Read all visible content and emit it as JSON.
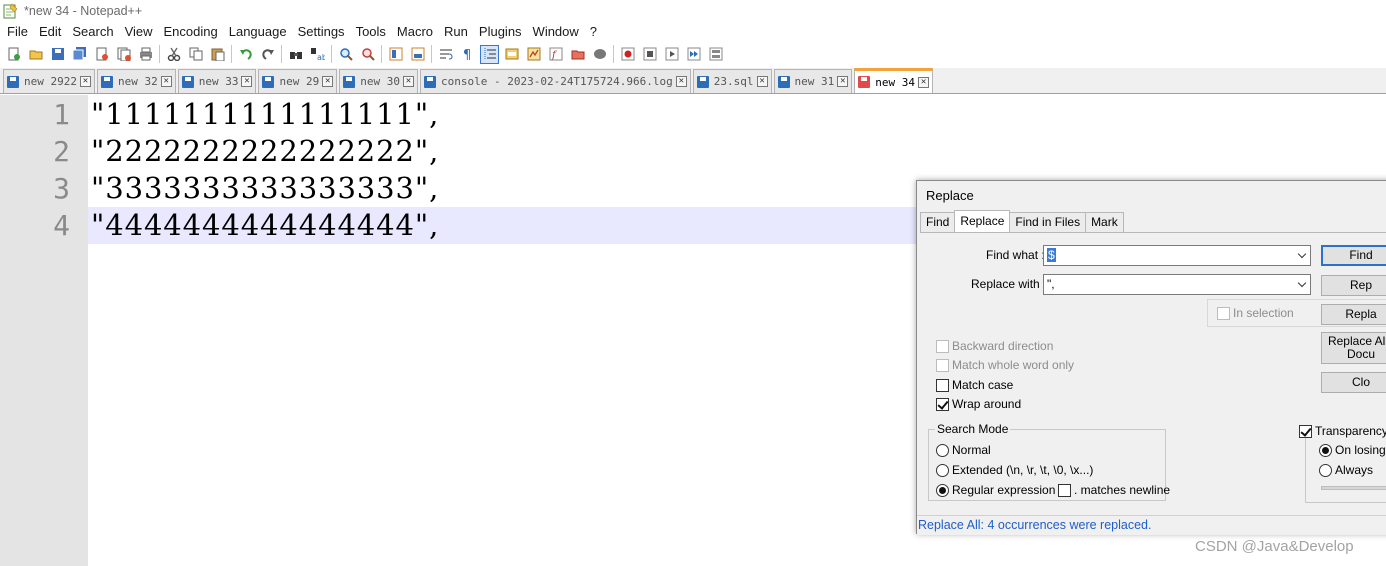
{
  "window": {
    "title": "*new 34 - Notepad++"
  },
  "menu": [
    "File",
    "Edit",
    "Search",
    "View",
    "Encoding",
    "Language",
    "Settings",
    "Tools",
    "Macro",
    "Run",
    "Plugins",
    "Window",
    "?"
  ],
  "toolbar_icons": [
    "new-file-icon",
    "open-file-icon",
    "save-icon",
    "save-all-icon",
    "close-icon",
    "close-all-icon",
    "print-icon",
    "cut-icon",
    "copy-icon",
    "paste-icon",
    "undo-icon",
    "redo-icon",
    "find-icon",
    "replace-icon",
    "zoom-in-icon",
    "zoom-out-icon",
    "sync-vertical-icon",
    "sync-horizontal-icon",
    "word-wrap-icon",
    "show-all-chars-icon",
    "indent-guide-icon",
    "user-language-icon",
    "document-map-icon",
    "function-list-icon",
    "folder-as-workspace-icon",
    "monitoring-icon",
    "record-macro-icon",
    "stop-record-icon",
    "play-macro-icon",
    "run-macro-multiple-icon",
    "save-macro-icon"
  ],
  "tabs": [
    {
      "label": "new 2922",
      "active": false
    },
    {
      "label": "new 32",
      "active": false
    },
    {
      "label": "new 33",
      "active": false
    },
    {
      "label": "new 29",
      "active": false
    },
    {
      "label": "new 30",
      "active": false
    },
    {
      "label": "console - 2023-02-24T175724.966.log",
      "active": false
    },
    {
      "label": "23.sql",
      "active": false
    },
    {
      "label": "new 31",
      "active": false
    },
    {
      "label": "new 34",
      "active": true
    }
  ],
  "editor": {
    "lines": [
      {
        "num": "1",
        "text": "\"1111111111111111\","
      },
      {
        "num": "2",
        "text": "\"2222222222222222\","
      },
      {
        "num": "3",
        "text": "\"3333333333333333\","
      },
      {
        "num": "4",
        "text": "\"4444444444444444\","
      }
    ],
    "current_line": 4
  },
  "dialog": {
    "title": "Replace",
    "tabs": [
      "Find",
      "Replace",
      "Find in Files",
      "Mark"
    ],
    "active_tab": "Replace",
    "find_label": "Find what :",
    "find_value": "$",
    "replace_label": "Replace with :",
    "replace_value": "\",",
    "in_selection": "In selection",
    "options": {
      "backward": "Backward direction",
      "whole_word": "Match whole word only",
      "match_case": "Match case",
      "wrap_around": "Wrap around"
    },
    "search_mode": {
      "title": "Search Mode",
      "normal": "Normal",
      "extended": "Extended (\\n, \\r, \\t, \\0, \\x...)",
      "regex": "Regular expression",
      "matches_newline": ". matches newline"
    },
    "transparency": {
      "title": "Transparency",
      "on_losing_focus": "On losing f",
      "always": "Always"
    },
    "buttons": {
      "find": "Find",
      "replace": "Rep",
      "replace_all": "Repla",
      "replace_all_docs_line1": "Replace All i",
      "replace_all_docs_line2": "Docu",
      "close": "Clo"
    },
    "status": "Replace All: 4 occurrences were replaced."
  },
  "watermark": "CSDN @Java&Develop",
  "colors": {
    "active_tab_accent": "#f3a33c",
    "current_line": "#e8e8ff",
    "status_text": "#1f5ec9"
  }
}
